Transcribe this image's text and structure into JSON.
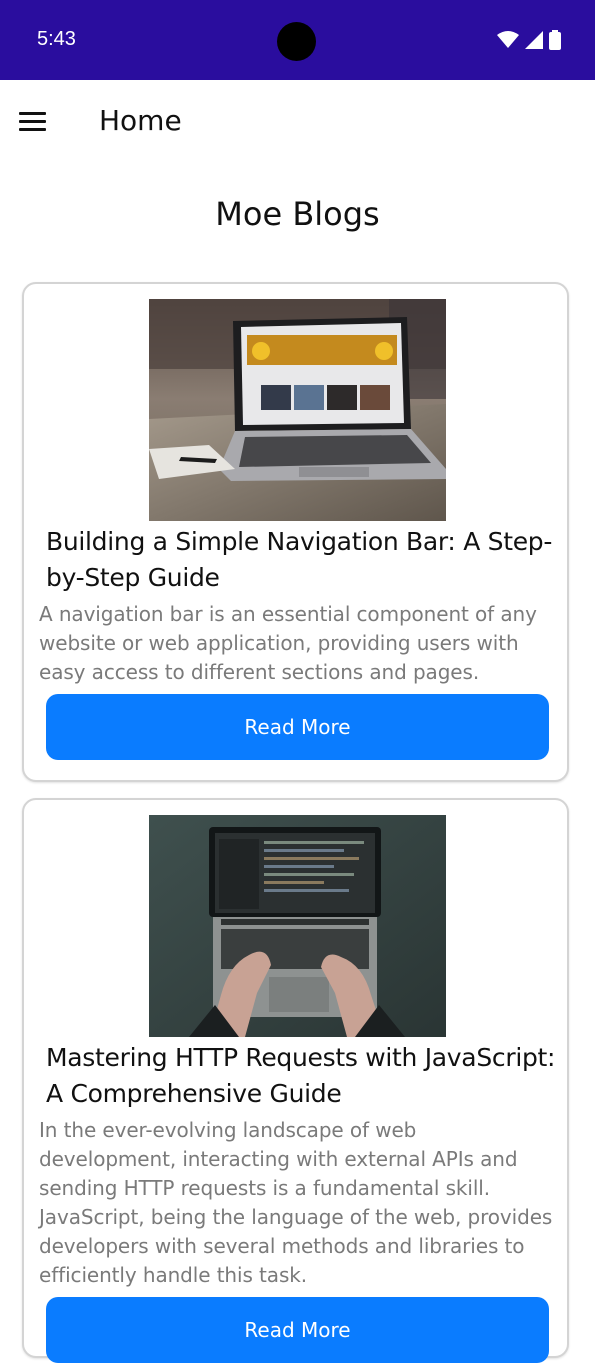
{
  "status_bar": {
    "time": "5:43",
    "background_color": "#2a0d9e",
    "icons": [
      "wifi-icon",
      "signal-icon",
      "battery-icon"
    ]
  },
  "app_bar": {
    "title": "Home",
    "menu_icon": "hamburger-menu-icon"
  },
  "page": {
    "title": "Moe Blogs"
  },
  "posts": [
    {
      "image": "laptop-on-wooden-desk-photo",
      "title": "Building a Simple Navigation Bar: A Step-by-Step Guide",
      "excerpt": "A navigation bar is an essential component of any website or web application, providing users with easy access to different sections and pages.",
      "button_label": "Read More"
    },
    {
      "image": "hands-typing-on-laptop-photo",
      "title": "Mastering HTTP Requests with JavaScript: A Comprehensive Guide",
      "excerpt": "In the ever-evolving landscape of web development, interacting with external APIs and sending HTTP requests is a fundamental skill. JavaScript, being the language of the web, provides developers with several methods and libraries to efficiently handle this task.",
      "button_label": "Read More"
    }
  ],
  "colors": {
    "accent": "#0a7cff",
    "excerpt_text": "#7a7a7a"
  }
}
